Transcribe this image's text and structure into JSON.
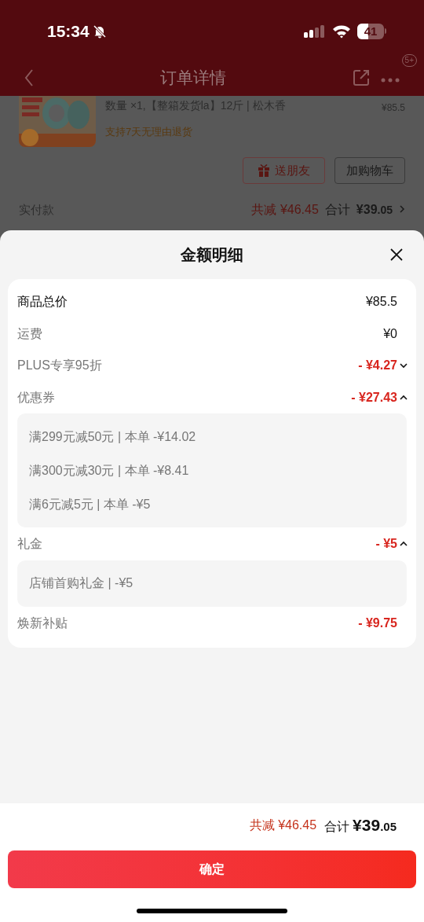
{
  "status_bar": {
    "time": "15:34",
    "battery": "41"
  },
  "header": {
    "title": "订单详情",
    "badge": "5+"
  },
  "product": {
    "spec": "数量 ×1,【整箱发货la】12斤 | 松木香",
    "price": "¥85.5",
    "return_policy": "支持7天无理由退货"
  },
  "actions": [
    {
      "label": "送朋友",
      "kind": "gift"
    },
    {
      "label": "加购物车",
      "kind": "plain"
    }
  ],
  "payment": {
    "label": "实付款",
    "saved": "共减 ¥46.45",
    "total_label": "合计",
    "total_main": "¥39",
    "total_cents": ".05"
  },
  "sheet": {
    "title": "金额明细",
    "rows": [
      {
        "kind": "total",
        "label": "商品总价",
        "amount": "¥85.5"
      },
      {
        "kind": "fee",
        "label": "运费",
        "amount": "¥0"
      },
      {
        "kind": "collapsible",
        "label": "PLUS专享95折",
        "amount": "- ¥4.27",
        "expanded": false
      },
      {
        "kind": "collapsible",
        "label": "优惠券",
        "amount": "- ¥27.43",
        "expanded": true,
        "details": [
          "满299元减50元 | 本单 -¥14.02",
          "满300元减30元 | 本单 -¥8.41",
          "满6元减5元 | 本单 -¥5"
        ]
      },
      {
        "kind": "collapsible",
        "label": "礼金",
        "amount": "- ¥5",
        "expanded": true,
        "details": [
          "店铺首购礼金 | -¥5"
        ]
      },
      {
        "kind": "discount",
        "label": "焕新补贴",
        "amount": "- ¥9.75"
      }
    ]
  },
  "footer": {
    "saved": "共减 ¥46.45",
    "total_label": "合计",
    "total_main": "¥39",
    "total_cents": ".05",
    "confirm": "确定"
  }
}
